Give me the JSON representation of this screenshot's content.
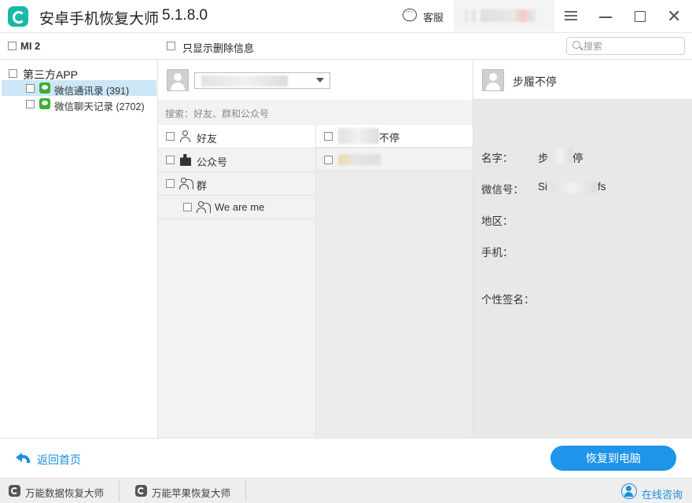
{
  "app": {
    "title": "安卓手机恢复大师",
    "version": "5.1.8.0",
    "service_label": "客服"
  },
  "toolbar": {
    "device_name": "MI 2",
    "show_deleted_label": "只显示删除信息",
    "search_placeholder": "搜索"
  },
  "tree": {
    "root_label": "第三方APP",
    "items": [
      {
        "label": "微信通讯录 (391)",
        "selected": true
      },
      {
        "label": "微信聊天记录 (2702)",
        "selected": false
      }
    ]
  },
  "middle": {
    "search_placeholder": "搜索：好友、群和公众号",
    "categories": [
      {
        "label": "好友",
        "icon": "person-icon"
      },
      {
        "label": "公众号",
        "icon": "official-account-icon"
      },
      {
        "label": "群",
        "icon": "group-icon"
      }
    ],
    "group_item": {
      "label": "We are me",
      "icon": "group-icon"
    },
    "contacts": [
      {
        "label": "不停"
      }
    ]
  },
  "detail": {
    "name": "步履不停",
    "fields": {
      "name_label": "名字：",
      "name_value": "步",
      "name_value_tail": "停",
      "wechat_label": "微信号：",
      "wechat_value": "Si",
      "wechat_value_tail": "fs",
      "region_label": "地区：",
      "phone_label": "手机：",
      "signature_label": "个性签名："
    }
  },
  "bottom": {
    "back_label": "返回首页",
    "recover_label": "恢复到电脑"
  },
  "footer": {
    "items": [
      "万能数据恢复大师",
      "万能苹果恢复大师"
    ],
    "consult_label": "在线咨询"
  },
  "colors": {
    "accent": "#1e95ea",
    "link": "#1a8fdd",
    "selected_row": "#cde6f7",
    "wechat": "#3cb034"
  }
}
